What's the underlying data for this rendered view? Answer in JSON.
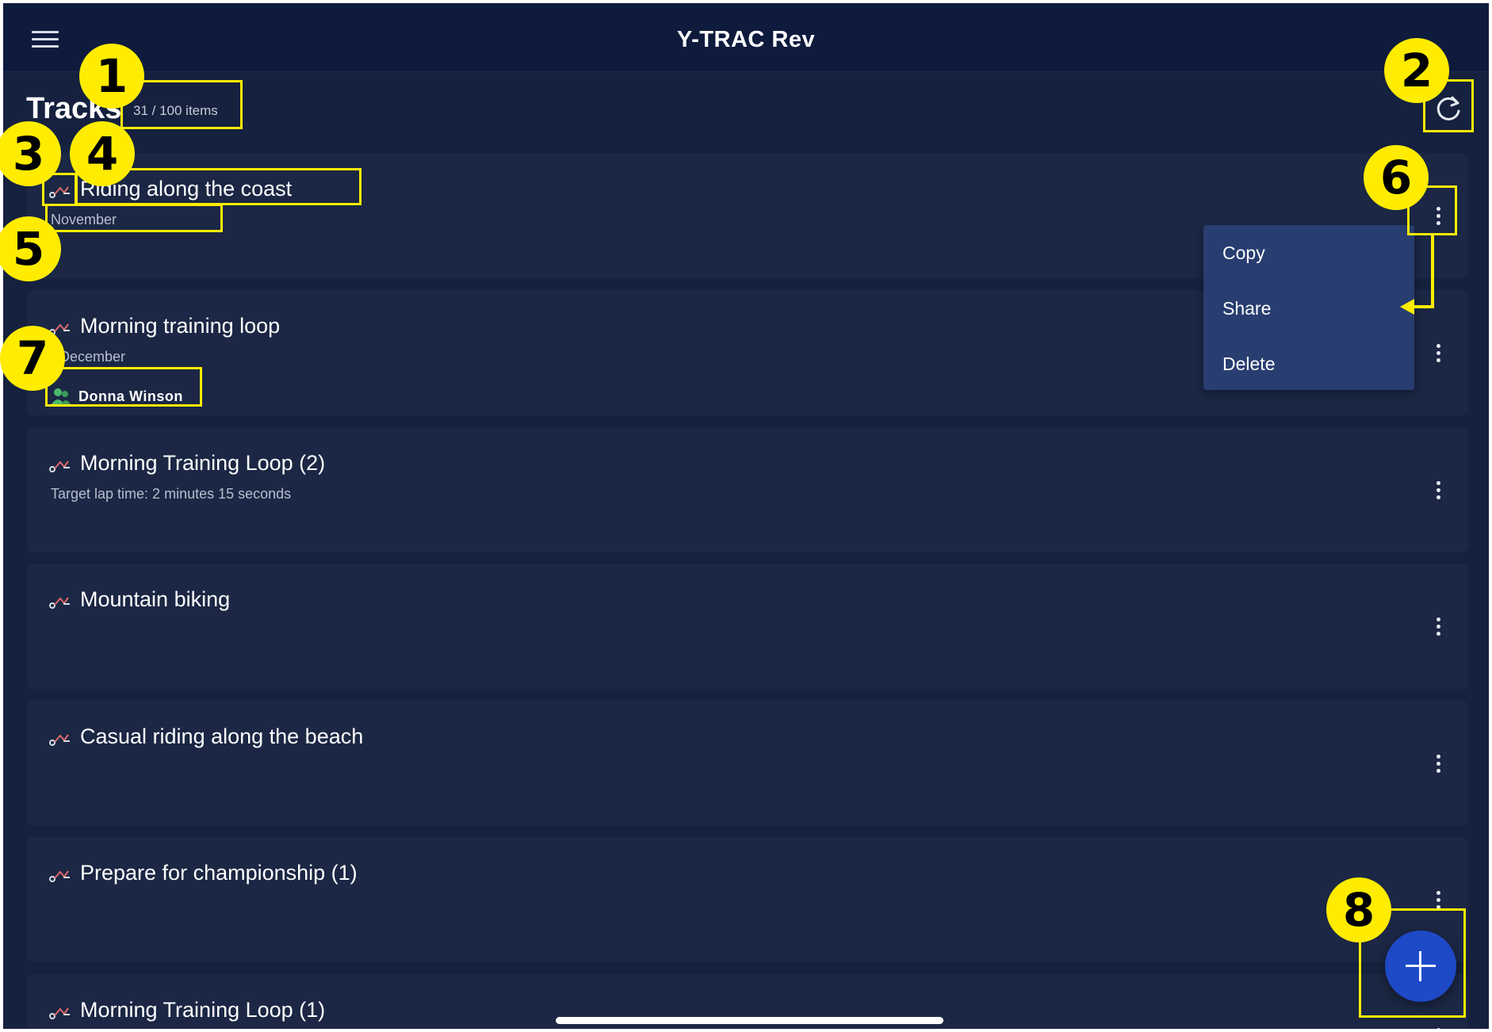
{
  "app": {
    "title": "Y-TRAC Rev",
    "page_title": "Tracks",
    "item_count": "31 / 100 items"
  },
  "tracks": [
    {
      "title": "Riding along the coast",
      "subtitle": "November"
    },
    {
      "title": "Morning training loop",
      "subtitle": "r December",
      "shared_by": "Donna Winson"
    },
    {
      "title": "Morning Training Loop (2)",
      "subtitle": "Target lap time: 2 minutes 15 seconds"
    },
    {
      "title": "Mountain biking",
      "subtitle": ""
    },
    {
      "title": "Casual riding along the beach",
      "subtitle": ""
    },
    {
      "title": "Prepare for championship (1)",
      "subtitle": ""
    },
    {
      "title": "Morning Training Loop (1)",
      "subtitle": ""
    }
  ],
  "context_menu": {
    "items": [
      "Copy",
      "Share",
      "Delete"
    ]
  },
  "callouts": [
    "1",
    "2",
    "3",
    "4",
    "5",
    "6",
    "7",
    "8"
  ],
  "icons": {
    "menu": "hamburger-icon",
    "refresh": "refresh-icon",
    "track": "track-route-icon",
    "more": "more-vertical-icon",
    "shared": "shared-users-icon",
    "add": "plus-icon"
  },
  "colors": {
    "background": "#15213e",
    "topbar": "#0f1b3d",
    "card": "#1b2744",
    "menu": "#283d70",
    "fab": "#1e49c7",
    "highlight": "#ffec00",
    "track_icon_accent": "#e06a6a",
    "shared_icon": "#4bb86a"
  }
}
